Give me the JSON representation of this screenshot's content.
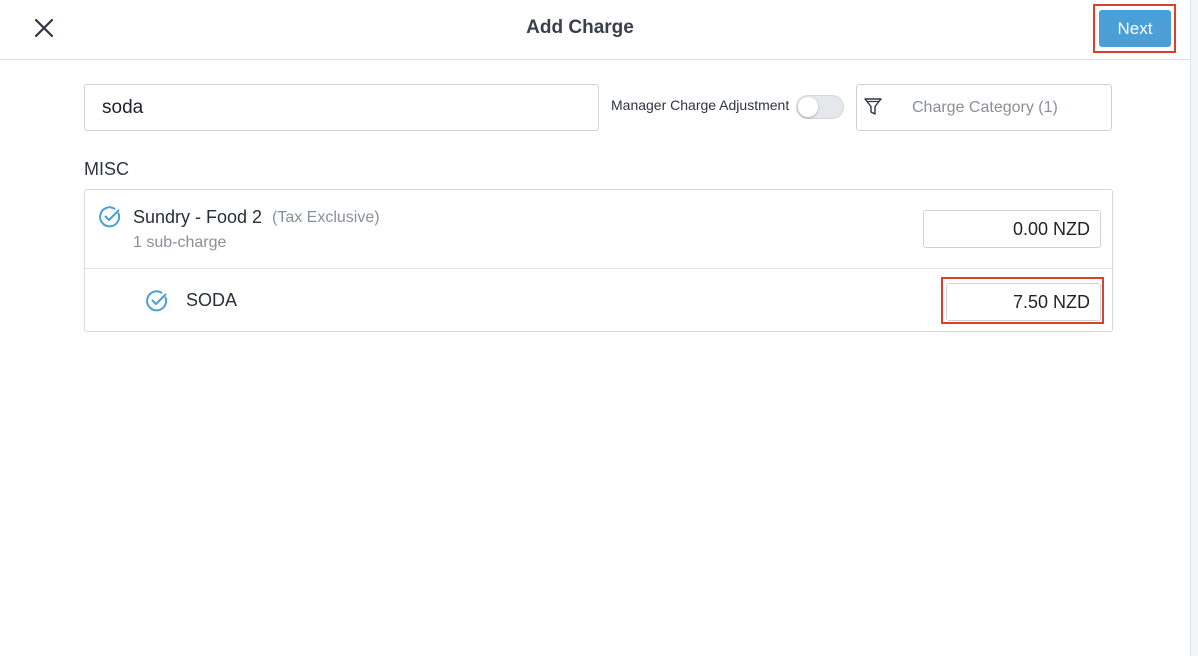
{
  "header": {
    "title": "Add Charge",
    "next_label": "Next",
    "close_icon": "close-icon",
    "highlight_color": "#d9412c",
    "accent_color": "#4a9fd6"
  },
  "filters": {
    "search_value": "soda",
    "manager_adjustment_label": "Manager Charge Adjustment",
    "manager_adjustment_on": false,
    "category_label": "Charge Category (1)",
    "category_icon": "filter-icon"
  },
  "section": {
    "title": "MISC"
  },
  "charges": {
    "parent": {
      "name": "Sundry - Food 2",
      "tax": "(Tax Exclusive)",
      "sub_count": "1 sub-charge",
      "amount": "0.00 NZD",
      "checked": true
    },
    "child": {
      "name": "SODA",
      "amount": "7.50 NZD",
      "checked": true
    }
  }
}
